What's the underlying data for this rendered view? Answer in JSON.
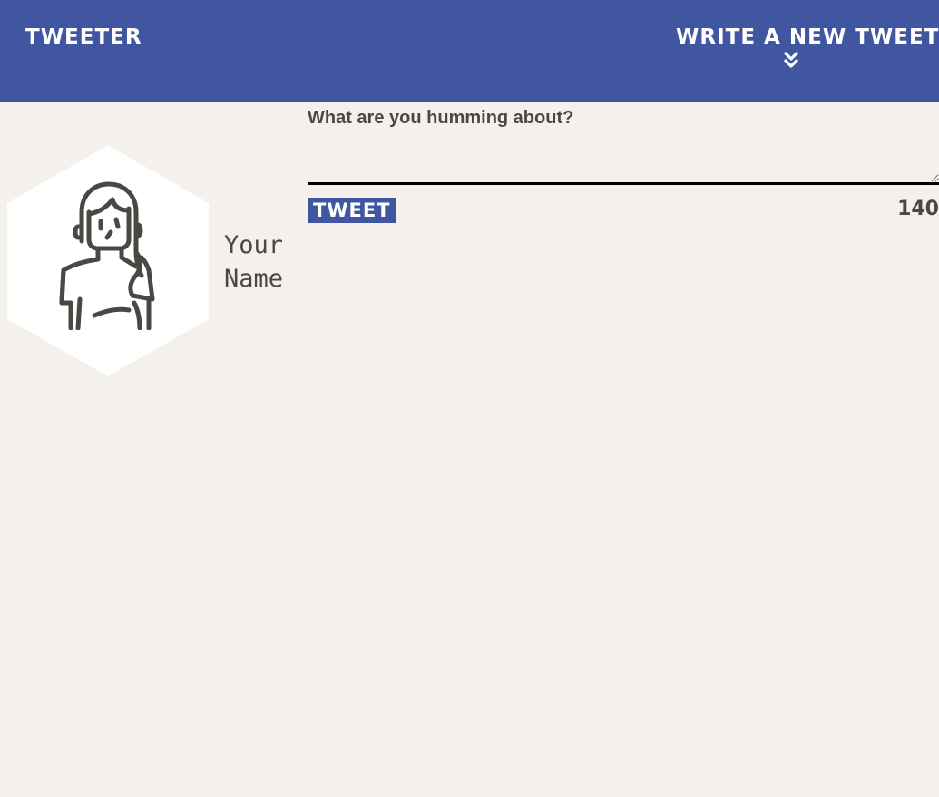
{
  "nav": {
    "brand": "TWEETER",
    "compose_label": "WRITE A NEW TWEET",
    "compose_icon": "double-chevron-down-icon"
  },
  "profile": {
    "avatar_icon": "user-avatar-icon",
    "name": "Your Name"
  },
  "composer": {
    "placeholder": "What are you humming about?",
    "value": "",
    "submit_label": "TWEET",
    "char_count": "140"
  },
  "colors": {
    "nav_background": "#4056a1",
    "page_background": "#f4f0eb",
    "text": "#4a4843",
    "accent": "#4056a1"
  }
}
